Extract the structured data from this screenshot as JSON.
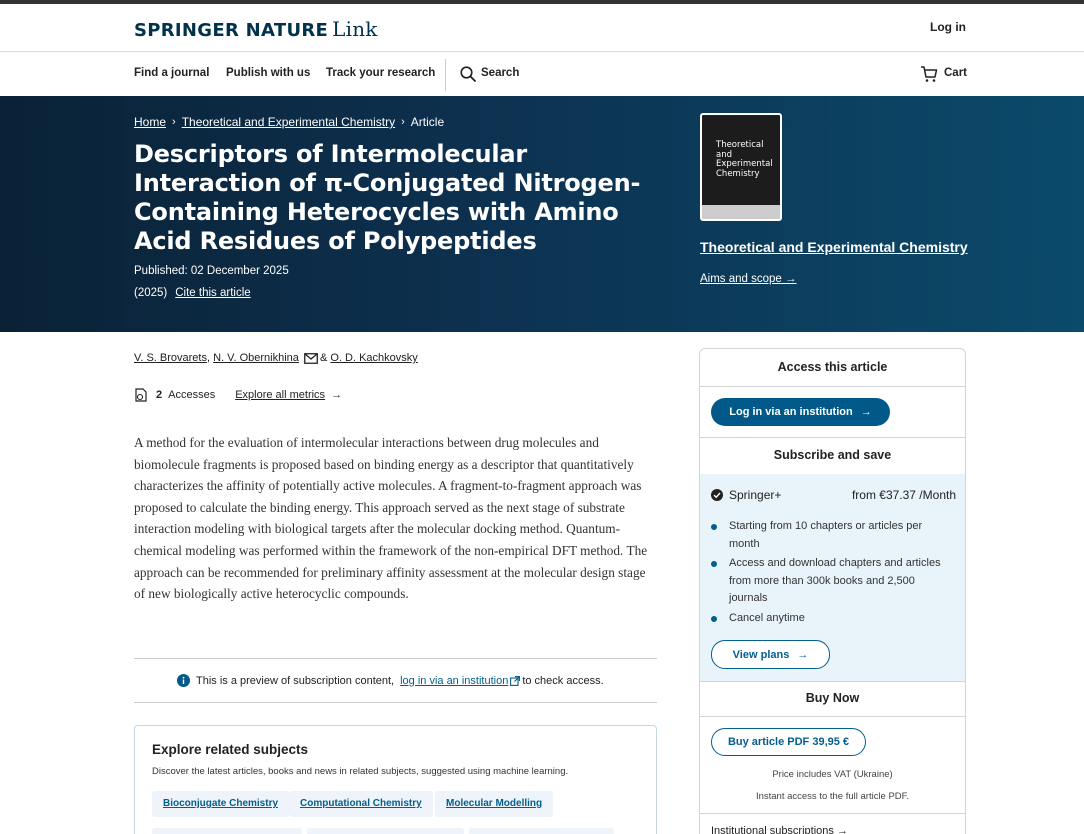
{
  "header": {
    "brand": "SPRINGER NATURE",
    "brand_link": "Link",
    "login": "Log in"
  },
  "nav": {
    "find_journal": "Find a journal",
    "publish": "Publish with us",
    "track": "Track your research",
    "search": "Search",
    "cart": "Cart"
  },
  "breadcrumb": {
    "home": "Home",
    "journal": "Theoretical and Experimental Chemistry",
    "current": "Article"
  },
  "article": {
    "title": "Descriptors of Intermolecular Interaction of π-Conjugated Nitrogen-Containing Heterocycles with Amino Acid Residues of Polypeptides",
    "published": "Published: 02 December 2025",
    "year": "(2025)",
    "cite": "Cite this article",
    "authors": [
      "V. S. Brovarets",
      "N. V. Obernikhina",
      "O. D. Kachkovsky"
    ],
    "author_sep_comma": ",",
    "author_sep_amp": "&",
    "accesses_count": "2",
    "accesses_label": "Accesses",
    "explore_metrics": "Explore all metrics",
    "abstract": "A method for the evaluation of intermolecular interactions between drug molecules and biomolecule fragments is proposed based on binding energy as a descriptor that quantitatively characterizes the affinity of potentially active molecules. A fragment-to-fragment approach was proposed to calculate the binding energy. This approach served as the next stage of substrate interaction modeling with biological targets after the molecular docking method. Quantum-chemical modeling was performed within the framework of the non-empirical DFT method. The approach can be recommended for preliminary affinity assessment at the molecular design stage of new biologically active heterocyclic compounds."
  },
  "journal": {
    "name": "Theoretical and Experimental Chemistry",
    "cover_title": "Theoretical and Experimental Chemistry",
    "aims": "Aims and scope"
  },
  "preview": {
    "text_before": "This is a preview of subscription content,",
    "link": "log in via an institution",
    "text_after": "to check access."
  },
  "related": {
    "title": "Explore related subjects",
    "subtitle": "Discover the latest articles, books and news in related subjects, suggested using machine learning.",
    "chips": [
      "Bioconjugate Chemistry",
      "Computational Chemistry",
      "Molecular Modelling"
    ]
  },
  "sidebar": {
    "access_title": "Access this article",
    "login_institution": "Log in via an institution",
    "subscribe_title": "Subscribe and save",
    "plan_name": "Springer+",
    "plan_price": "from €37.37 /Month",
    "plan_features": [
      "Starting from 10 chapters or articles per month",
      "Access and download chapters and articles from more than 300k books and 2,500 journals",
      "Cancel anytime"
    ],
    "view_plans": "View plans",
    "buy_title": "Buy Now",
    "buy_button": "Buy article PDF 39,95 €",
    "vat_note": "Price includes VAT (Ukraine)",
    "instant_note": "Instant access to the full article PDF.",
    "institutional": "Institutional subscriptions →"
  },
  "colors": {
    "brand_blue": "#01598a",
    "link_blue": "#025e8d",
    "hero_dark": "#0a2236"
  }
}
